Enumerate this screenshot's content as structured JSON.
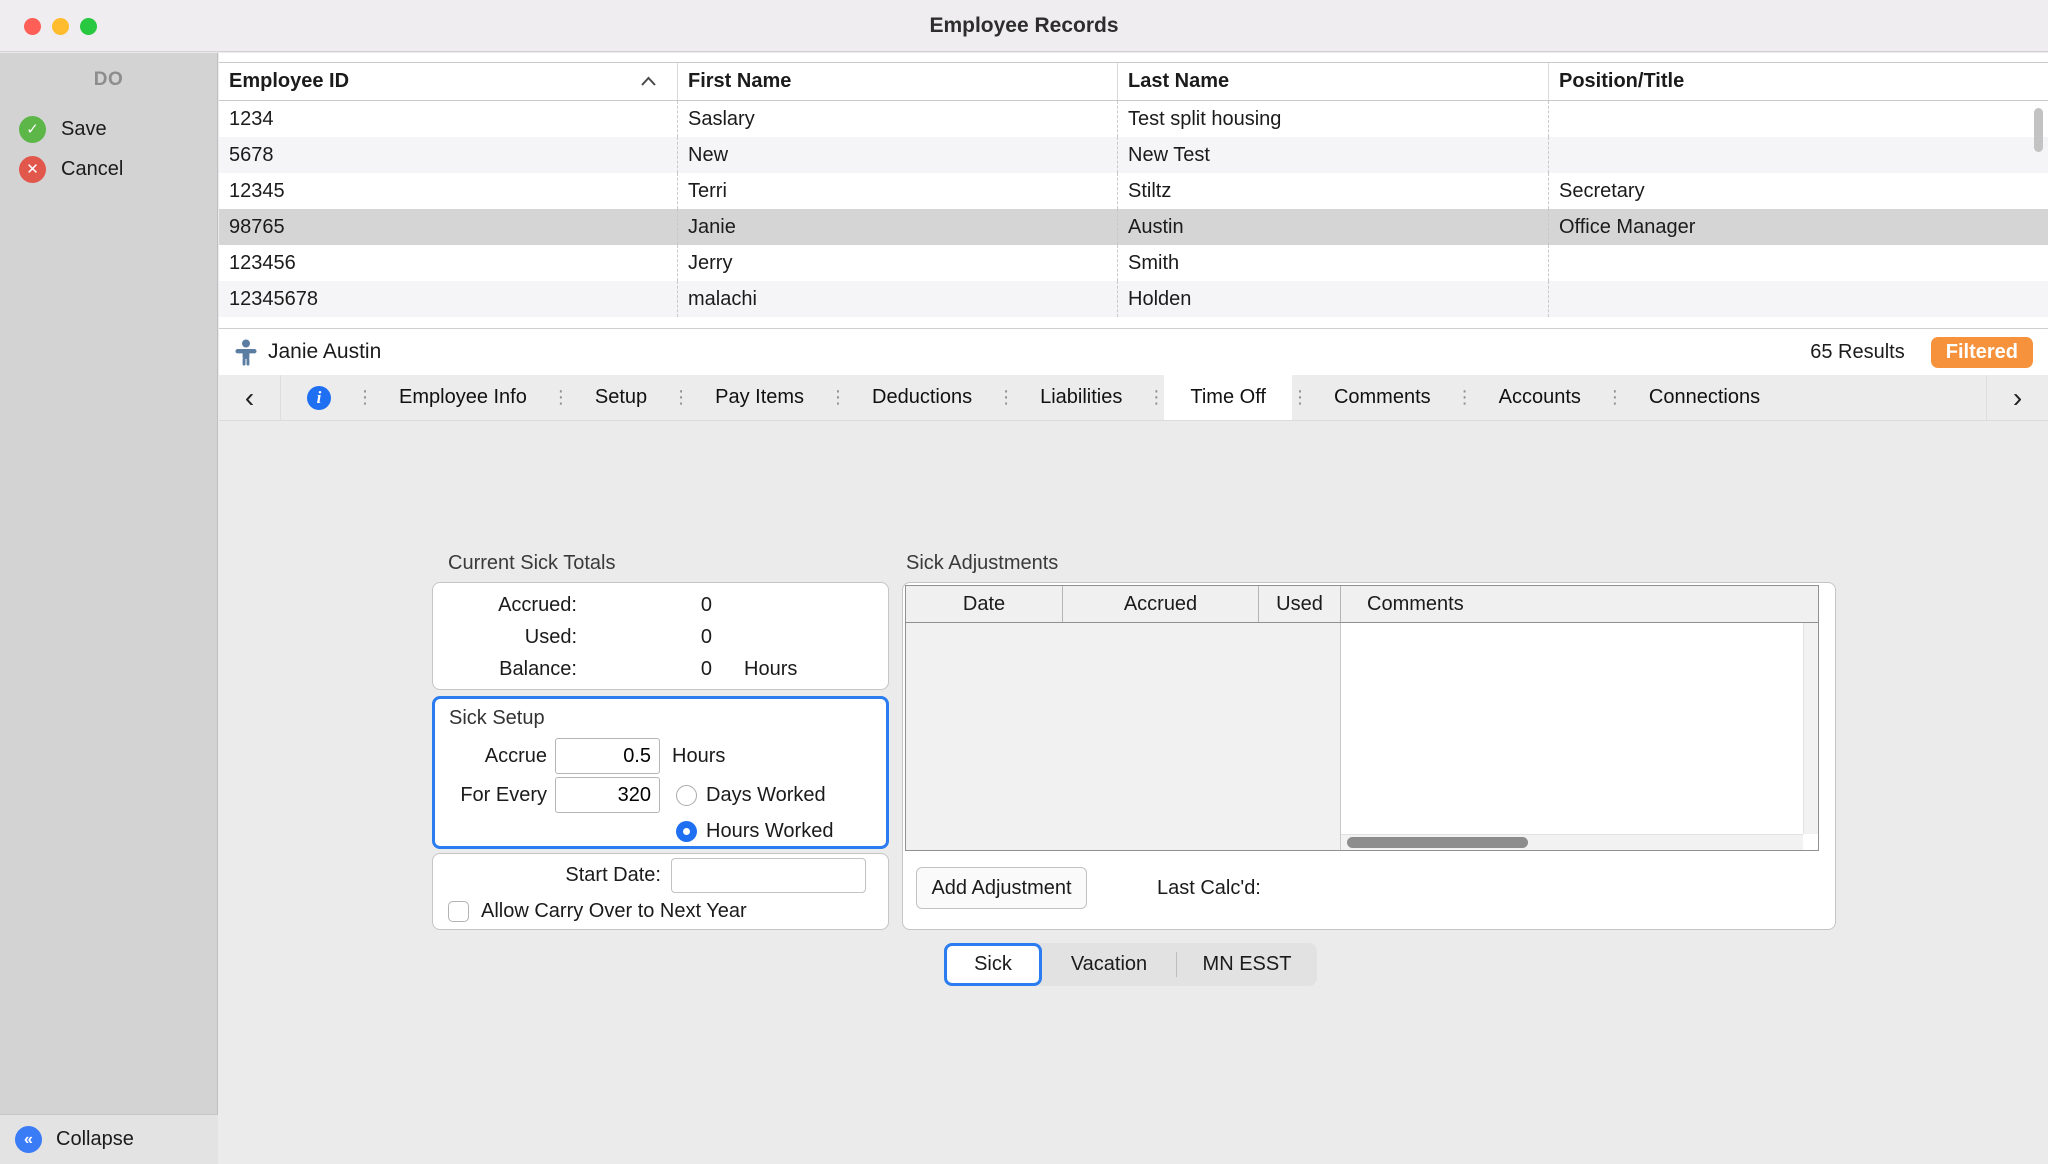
{
  "colors": {
    "accent_blue": "#2b7cf0",
    "filtered_orange": "#f6923c",
    "save_green": "#5cb648",
    "cancel_red": "#e2574b"
  },
  "icons": {
    "info": "i",
    "chevron_left": "‹",
    "chevron_right": "›",
    "tab_handle": "⋮",
    "save_check": "✓",
    "cancel_x": "✕",
    "collapse_chevrons": "«",
    "sort_asc": "chevron-up",
    "person": "person-figure"
  },
  "window": {
    "title": "Employee Records"
  },
  "sidebar": {
    "header": "DO",
    "save_label": "Save",
    "cancel_label": "Cancel",
    "collapse_label": "Collapse"
  },
  "employee_table": {
    "columns": [
      "Employee ID",
      "First Name",
      "Last Name",
      "Position/Title"
    ],
    "rows": [
      [
        "1234",
        "Saslary",
        "Test split housing",
        ""
      ],
      [
        "5678",
        "New",
        "New Test",
        ""
      ],
      [
        "12345",
        "Terri",
        "Stiltz",
        "Secretary"
      ],
      [
        "98765",
        "Janie",
        "Austin",
        "Office Manager"
      ],
      [
        "123456",
        "Jerry",
        "Smith",
        ""
      ],
      [
        "12345678",
        "malachi",
        "Holden",
        ""
      ]
    ],
    "selected_row": "98765"
  },
  "record_bar": {
    "name": "Janie Austin",
    "results": "65 Results",
    "filter_badge": "Filtered"
  },
  "tabs": {
    "items": [
      "Employee Info",
      "Setup",
      "Pay Items",
      "Deductions",
      "Liabilities",
      "Time Off",
      "Comments",
      "Accounts",
      "Connections"
    ],
    "selected": "Time Off"
  },
  "time_off": {
    "totals": {
      "title": "Current Sick Totals",
      "rows": [
        [
          "Accrued:",
          "0",
          ""
        ],
        [
          "Used:",
          "0",
          ""
        ],
        [
          "Balance:",
          "0",
          "Hours"
        ]
      ]
    },
    "setup": {
      "title": "Sick Setup",
      "accrue_label": "Accrue",
      "accrue_value": "0.5",
      "accrue_unit": "Hours",
      "for_every_label": "For Every",
      "for_every_value": "320",
      "radio_days_label": "Days Worked",
      "radio_hours_label": "Hours Worked",
      "selected_radio": "Hours Worked"
    },
    "start": {
      "date_label": "Start Date:",
      "date_value": "",
      "carry_checkbox_label": "Allow Carry Over to Next Year",
      "carry_checked": false
    },
    "adjustments": {
      "title": "Sick Adjustments",
      "columns": [
        "Date",
        "Accrued",
        "Used",
        "Comments"
      ],
      "rows": [],
      "add_button_label": "Add Adjustment",
      "last_calcd_label": "Last Calc'd:"
    },
    "bottom_tabs": {
      "items": [
        "Sick",
        "Vacation",
        "MN ESST"
      ],
      "selected": "Sick"
    }
  }
}
